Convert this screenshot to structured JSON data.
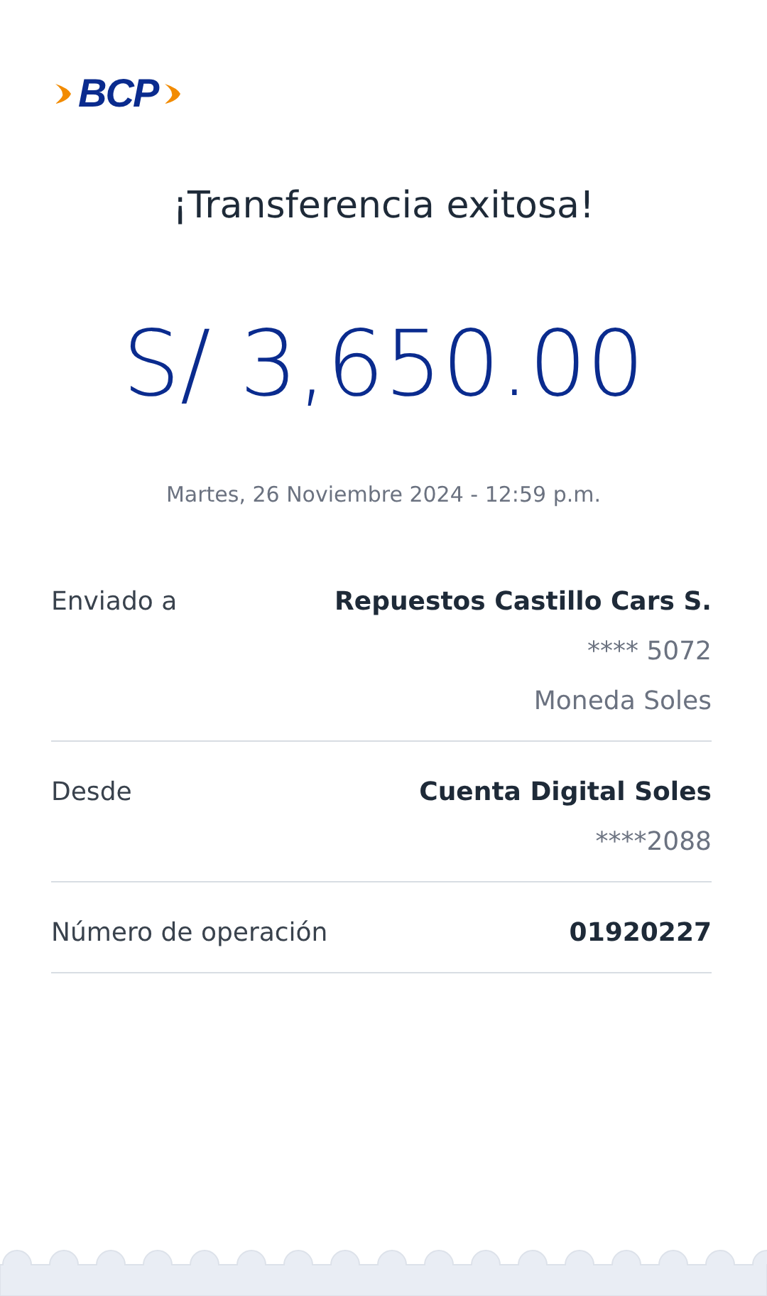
{
  "logo": {
    "text": "BCP"
  },
  "title": "¡Transferencia exitosa!",
  "amount": "S/ 3,650.00",
  "datetime": "Martes, 26 Noviembre 2024 - 12:59 p.m.",
  "details": [
    {
      "label": "Enviado a",
      "lines": [
        {
          "text": "Repuestos Castillo Cars S.",
          "kind": "primary"
        },
        {
          "text": "**** 5072",
          "kind": "secondary"
        },
        {
          "text": "Moneda Soles",
          "kind": "secondary"
        }
      ]
    },
    {
      "label": "Desde",
      "lines": [
        {
          "text": "Cuenta Digital Soles",
          "kind": "primary"
        },
        {
          "text": "****2088",
          "kind": "secondary"
        }
      ]
    },
    {
      "label": "Número de operación",
      "lines": [
        {
          "text": "01920227",
          "kind": "primary"
        }
      ]
    }
  ]
}
